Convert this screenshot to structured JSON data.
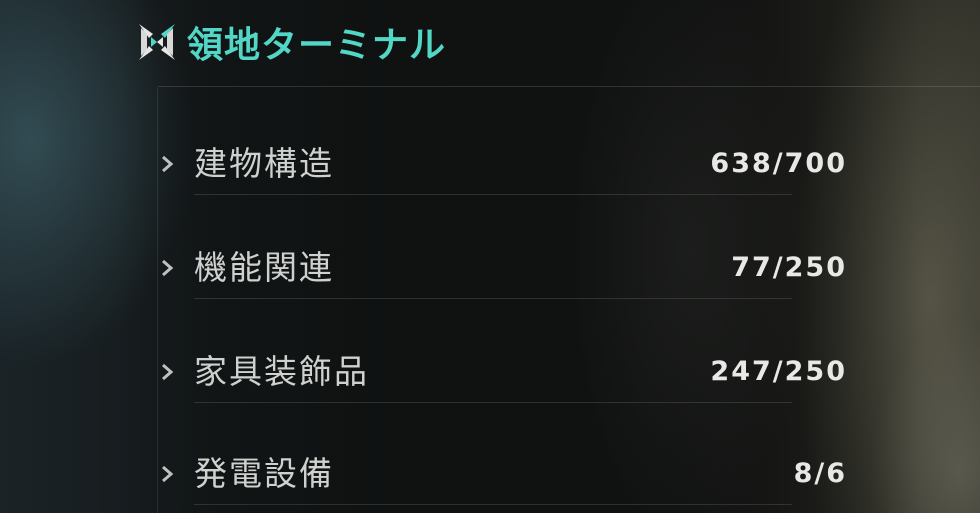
{
  "header": {
    "title": "領地ターミナル",
    "logo_icon": "crossed-blades-logo-icon",
    "accent_color": "#52d6c6"
  },
  "categories": [
    {
      "label": "建物構造",
      "count": "638/700",
      "icon": "chevron-right-icon"
    },
    {
      "label": "機能関連",
      "count": "77/250",
      "icon": "chevron-right-icon"
    },
    {
      "label": "家具装飾品",
      "count": "247/250",
      "icon": "chevron-right-icon"
    },
    {
      "label": "発電設備",
      "count": "8/6",
      "icon": "chevron-right-icon"
    }
  ]
}
